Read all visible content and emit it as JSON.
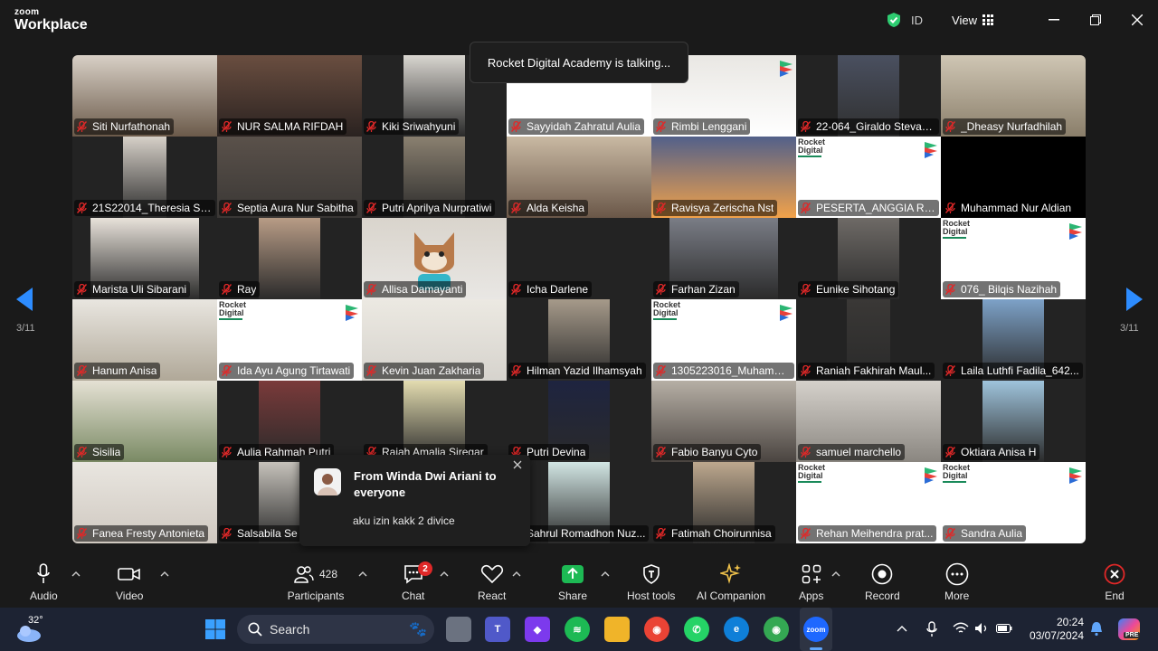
{
  "app": {
    "brand_small": "zoom",
    "brand_big": "Workplace"
  },
  "titlebar": {
    "id_label": "ID",
    "view_label": "View"
  },
  "talking": "Rocket Digital Academy is talking...",
  "nav": {
    "left_page": "3/11",
    "right_page": "3/11"
  },
  "tiles": [
    "Siti Nurfathonah",
    "NUR SALMA RIFDAH",
    "Kiki Sriwahyuni",
    "Sayyidah Zahratul Aulia",
    "Rimbi Lenggani",
    "22-064_Giraldo Stevan...",
    "_Dheasy Nurfadhilah",
    "21S22014_Theresia Sin...",
    "Septia Aura Nur Sabitha",
    "Putri Aprilya Nurpratiwi",
    "Alda Keisha",
    "Ravisya Zerischa Nst",
    "PESERTA_ANGGIA REV...",
    "Muhammad Nur Aldian",
    "Marista Uli Sibarani",
    "Ray",
    "Allisa Damayanti",
    "Icha Darlene",
    "Farhan Zizan",
    "Eunike Sihotang",
    "076_ Bilqis Nazihah",
    "Hanum Anisa",
    "Ida Ayu Agung Tirtawati",
    "Kevin Juan Zakharia",
    "Hilman Yazid Ilhamsyah",
    "1305223016_Muhamm...",
    "Raniah Fakhirah Maul...",
    "Laila Luthfi Fadila_642...",
    "Sisilia",
    "Aulia Rahmah Putri",
    "Raiah Amalia Siregar",
    "Putri Devina",
    "Fabio Banyu Cyto",
    "samuel marchello",
    "Oktiara Anisa H",
    "Fanea Fresty Antonieta",
    "Salsabila Se",
    "",
    "Sahrul Romadhon Nuz...",
    "Fatimah Choirunnisa",
    "Rehan Meihendra prat...",
    "Sandra Aulia"
  ],
  "rocket_logo": [
    "Rocket",
    "Digital"
  ],
  "chat_popup": {
    "from": "From Winda Dwi Ariani to everyone",
    "message": "aku izin kakk 2 divice"
  },
  "toolbar": {
    "audio": "Audio",
    "video": "Video",
    "participants": "Participants",
    "participants_count": "428",
    "chat": "Chat",
    "chat_badge": "2",
    "react": "React",
    "share": "Share",
    "host_tools": "Host tools",
    "ai_companion": "AI Companion",
    "apps": "Apps",
    "record": "Record",
    "more": "More",
    "end": "End"
  },
  "taskbar": {
    "temp": "32°",
    "search_placeholder": "Search",
    "time": "20:24",
    "date": "03/07/2024",
    "copilot_badge": "PRE"
  },
  "colors": {
    "accent_blue": "#2d8cff",
    "end_red": "#e02828",
    "share_green": "#1db954",
    "shield_green": "#2ecc71"
  }
}
